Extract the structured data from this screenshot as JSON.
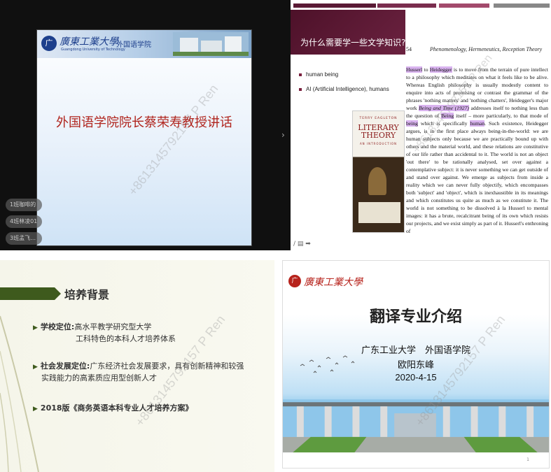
{
  "panel1": {
    "uni_logo_char": "广",
    "uni_name": "廣東工業大學",
    "uni_sub": "Guangdong University of Technology",
    "school_tag": "外国语学院",
    "talk_title": "外国语学院院长蔡荣寿教授讲话",
    "chips": [
      "1班咖啡的",
      "4班林凌01",
      "3班孟飞…"
    ],
    "next_icon": "›"
  },
  "panel2": {
    "header_text": "为什么需要学一些文学知识?",
    "bullets": [
      "human being",
      "AI (Artificial Intelligence), humans"
    ],
    "book": {
      "author": "TERRY EAGLETON",
      "title_line1": "LITERARY",
      "title_line2": "THEORY",
      "subtitle": "AN INTRODUCTION"
    },
    "page_number": "54",
    "running_head": "Phenomenology, Hermeneutics, Reception Theory",
    "body": {
      "w1": "Husserl",
      "t1": " to ",
      "w2": "Heidegger",
      "t2": " is to move from the terrain of pure intellect to a philosophy which meditates on what it feels like to be alive. Whereas English philosophy is usually modestly content to enquire into acts of promising or contrast the grammar of the phrases 'nothing matters' and 'nothing chatters', Heidegger's major work ",
      "w3": "Being and Time (1927)",
      "t3": " addresses itself to nothing less than the question of ",
      "w4": "Being",
      "t4": " itself – more particularly, to that mode of ",
      "w5": "being",
      "t5": " which is specifically ",
      "w6": "human",
      "t6": ". Such existence, Heidegger argues, is in the first place always being-in-the-world: we are human subjects only because we are practically bound up with others and the material world, and these relations are constitutive of our life rather than accidental to it. The world is not an object 'out there' to be rationally analysed, set over against a contemplative subject: it is never something we can get outside of and stand over against. We emerge as subjects from inside a reality which we can never fully objectify, which encompasses both 'subject' and 'object', which is inexhaustible in its meanings and which constitutes us quite as much as we constitute it. The world is not something to be dissolved à la Husserl to mental images: it has a brute, recalcitrant being of its own which resists our projects, and we exist simply as part of it. Husserl's enthroning of"
    },
    "toolbar_icons": "/ ▤ ➡"
  },
  "panel3": {
    "heading": "培养背景",
    "item1_label": "学校定位:",
    "item1_text": "高水平教学研究型大学",
    "item1_cont": "工科特色的本科人才培养体系",
    "item2_label": "社会发展定位:",
    "item2_text": "广东经济社会发展要求，具有创新精神和较强",
    "item2_cont": "实践能力的高素质应用型创新人才",
    "item3_text": "2018版《商务英语本科专业人才培养方案》"
  },
  "panel4": {
    "logo_char": "广",
    "uni_name": "廣東工業大學",
    "title": "翻译专业介绍",
    "line1": "广东工业大学　外国语学院",
    "line2": "欧阳东峰",
    "line3": "2020-4-15",
    "page_num": "1"
  },
  "watermarks": [
    "+8613145792157 P Ren",
    "+8613145792157 P Ren",
    "+8613145792157 P Ren",
    "+8613145792157 P Ren"
  ]
}
